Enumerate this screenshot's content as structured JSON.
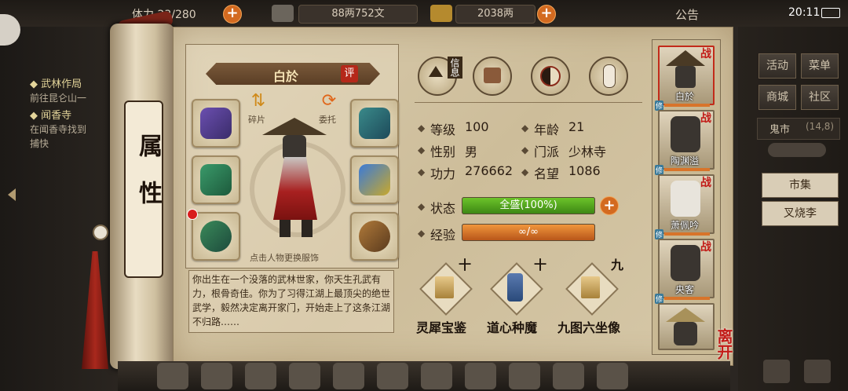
{
  "topbar": {
    "stamina": "体力 23/280",
    "silver": "88两752文",
    "gold": "2038两",
    "notice": "公告",
    "clock": "20:11"
  },
  "quests": [
    {
      "title": "武林作局",
      "desc": "前往昆仑山一"
    },
    {
      "title": "闻香寺",
      "desc": "在闻香寺找到",
      "desc2": "捕快"
    }
  ],
  "scroll": {
    "title": "属性"
  },
  "character": {
    "name": "白於",
    "rate_badge": "评",
    "click_hint": "点击人物更换服饰",
    "fragment_label": "碎片",
    "entrust_label": "委托"
  },
  "tabs": [
    {
      "icon": "info-hat-icon",
      "label": "信息"
    },
    {
      "icon": "book-bag-icon",
      "label": ""
    },
    {
      "icon": "bagua-icon",
      "label": ""
    },
    {
      "icon": "martial-figure-icon",
      "label": ""
    }
  ],
  "stats": [
    {
      "label": "等级",
      "value": "100"
    },
    {
      "label": "年龄",
      "value": "21"
    },
    {
      "label": "性别",
      "value": "男"
    },
    {
      "label": "门派",
      "value": "少林寺"
    },
    {
      "label": "功力",
      "value": "276662"
    },
    {
      "label": "名望",
      "value": "1086"
    }
  ],
  "status": {
    "label": "状态",
    "value": "全盛(100%)",
    "fill": 1.0
  },
  "experience": {
    "label": "经验",
    "value": "∞/∞",
    "fill": 1.0
  },
  "description": "你出生在一个没落的武林世家，你天生孔武有力，根骨奇佳。你为了习得江湖上最顶尖的绝世武学，毅然决定离开家门，开始走上了这条江湖不归路……",
  "books": [
    {
      "name": "灵犀宝鉴",
      "count": "十"
    },
    {
      "name": "道心种魔",
      "count": "十"
    },
    {
      "name": "九图六坐像",
      "count": "九"
    }
  ],
  "roster": [
    {
      "name": "白於",
      "tag": "战",
      "xiu": "修",
      "selected": true
    },
    {
      "name": "陶渊溢",
      "tag": "战",
      "xiu": "修"
    },
    {
      "name": "萧佩吟",
      "tag": "战",
      "xiu": "修"
    },
    {
      "name": "央客",
      "tag": "战",
      "xiu": "修"
    },
    {
      "name": "",
      "tag": "",
      "xiu": ""
    }
  ],
  "leave_label": "离开",
  "right_menu": {
    "buttons": [
      "活动",
      "菜单",
      "商城",
      "社区"
    ],
    "ghost_market": "鬼市",
    "ghost_coords": "(14,8)",
    "market": "市集",
    "npc": "叉烧李"
  },
  "colors": {
    "status_green": "#4f9a1e",
    "exp_orange": "#d8742a",
    "accent_red": "#c21b17"
  }
}
